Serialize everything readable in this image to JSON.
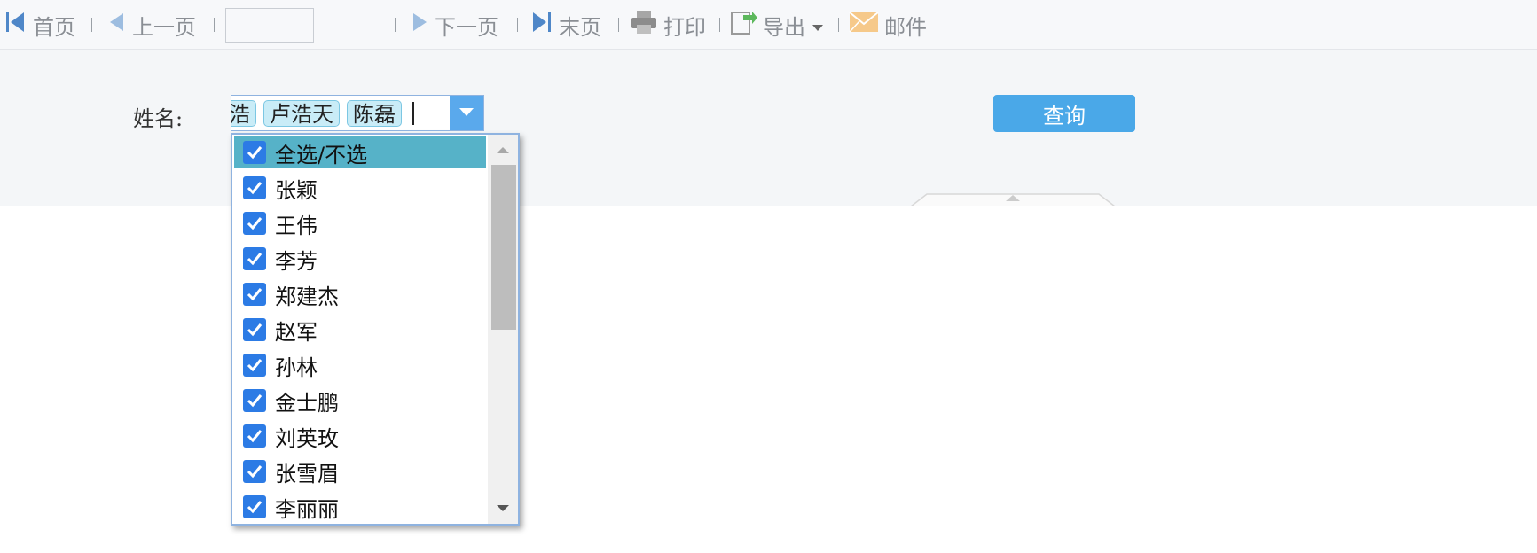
{
  "toolbar": {
    "first_label": "首页",
    "prev_label": "上一页",
    "page_input_value": "",
    "next_label": "下一页",
    "last_label": "末页",
    "print_label": "打印",
    "export_label": "导出",
    "mail_label": "邮件"
  },
  "filter": {
    "name_label": "姓名:",
    "selected_tags": [
      "浩",
      "卢浩天",
      "陈磊"
    ],
    "query_label": "查询"
  },
  "dropdown": {
    "options": [
      {
        "label": "全选/不选",
        "checked": true
      },
      {
        "label": "张颖",
        "checked": true
      },
      {
        "label": "王伟",
        "checked": true
      },
      {
        "label": "李芳",
        "checked": true
      },
      {
        "label": "郑建杰",
        "checked": true
      },
      {
        "label": "赵军",
        "checked": true
      },
      {
        "label": "孙林",
        "checked": true
      },
      {
        "label": "金士鹏",
        "checked": true
      },
      {
        "label": "刘英玫",
        "checked": true
      },
      {
        "label": "张雪眉",
        "checked": true
      },
      {
        "label": "李丽丽",
        "checked": true
      }
    ]
  },
  "colors": {
    "accent": "#4aa8e8",
    "tag_bg": "#c9ecf7",
    "selected_row": "#56b2c8",
    "checkbox": "#2c7be5"
  },
  "icons": [
    "first-page-icon",
    "prev-page-icon",
    "next-page-icon",
    "last-page-icon",
    "printer-icon",
    "export-icon",
    "mail-icon",
    "chevron-down-icon",
    "checkmark-icon"
  ]
}
